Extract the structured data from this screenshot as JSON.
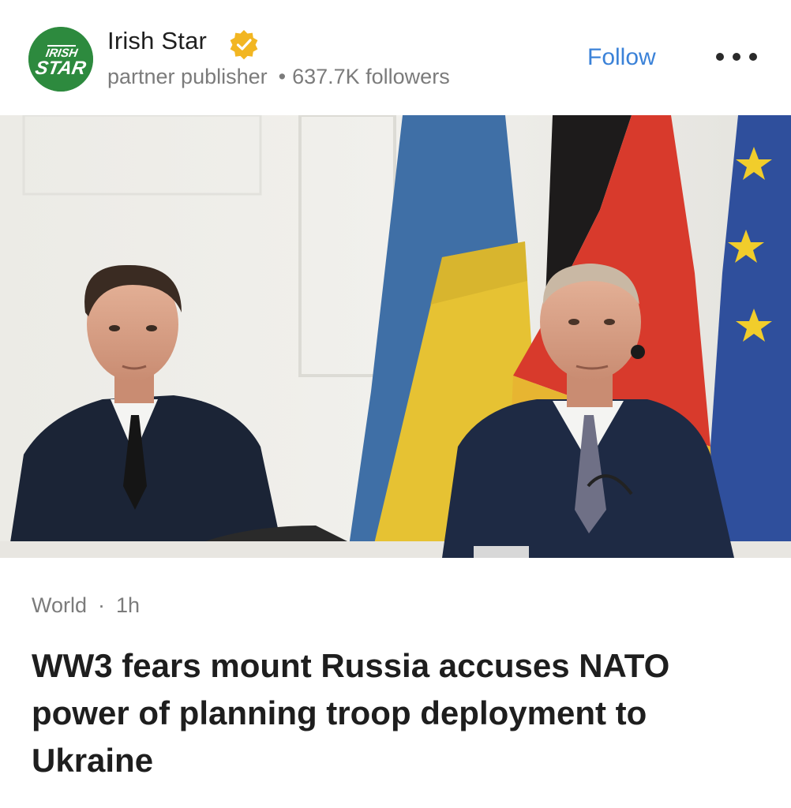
{
  "publisher": {
    "name": "Irish Star",
    "logo_text_top": "IRISH",
    "logo_text_bottom": "STAR",
    "role": "partner publisher",
    "separator": "•",
    "followers": "637.7K followers",
    "verified_icon": "verified-badge-icon"
  },
  "actions": {
    "follow_label": "Follow",
    "more_icon": "more-options-icon"
  },
  "article": {
    "category": "World",
    "separator": "·",
    "age": "1h",
    "headline": "WW3 fears mount Russia accuses NATO power of planning troop deployment to Ukraine"
  },
  "colors": {
    "logo_green": "#2d8a3e",
    "follow_blue": "#3b82d8",
    "verified_gold": "#f2b622",
    "muted_text": "#7b7b7b"
  }
}
